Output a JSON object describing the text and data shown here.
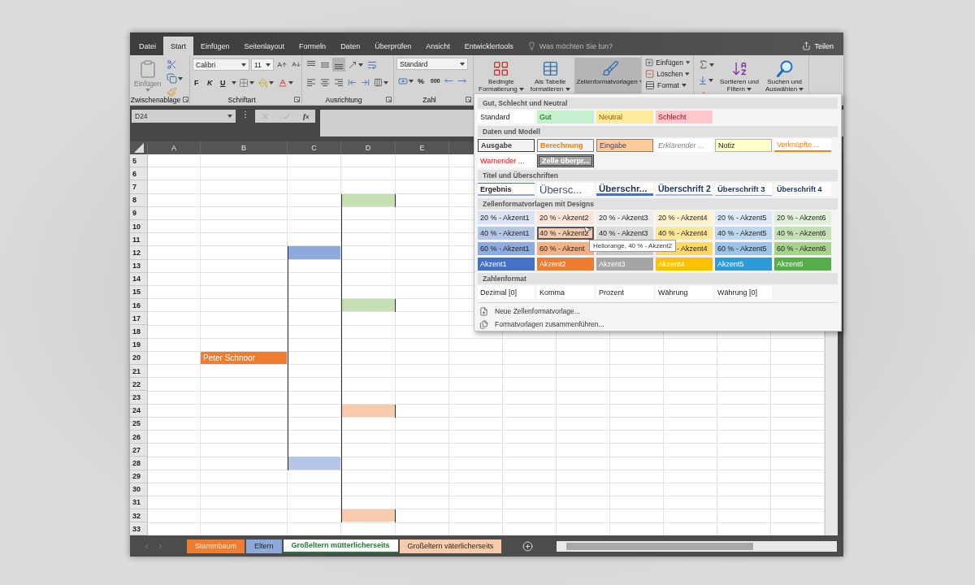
{
  "ribbon_tabs": [
    {
      "label": "Datei",
      "selected": false
    },
    {
      "label": "Start",
      "selected": true
    },
    {
      "label": "Einfügen",
      "selected": false
    },
    {
      "label": "Seitenlayout",
      "selected": false
    },
    {
      "label": "Formeln",
      "selected": false
    },
    {
      "label": "Daten",
      "selected": false
    },
    {
      "label": "Überprüfen",
      "selected": false
    },
    {
      "label": "Ansicht",
      "selected": false
    },
    {
      "label": "Entwicklertools",
      "selected": false
    }
  ],
  "tell_me": {
    "placeholder": "Was möchten Sie tun?"
  },
  "share": {
    "label": "Teilen"
  },
  "ribbon": {
    "clipboard": {
      "paste_label": "Einfügen",
      "group_label": "Zwischenablage"
    },
    "font": {
      "name": "Calibri",
      "size": "11",
      "bold": "F",
      "italic": "K",
      "underline": "U",
      "group_label": "Schriftart"
    },
    "alignment": {
      "vertical_buttons": [
        {
          "selected": false
        },
        {
          "selected": false
        },
        {
          "selected": true
        }
      ],
      "group_label": "Ausrichtung"
    },
    "number": {
      "format": "Standard",
      "percent": "%",
      "thousands": "000",
      "group_label": "Zahl"
    },
    "styles": [
      {
        "label": "Bedingte\nFormatierung",
        "kind": "conditional",
        "pressed": false
      },
      {
        "label": "Als Tabelle\nformatieren",
        "kind": "table",
        "pressed": false
      },
      {
        "label": "Zellenformatvorlagen",
        "kind": "cellstyles",
        "pressed": true
      }
    ],
    "cells": [
      {
        "label": "Einfügen",
        "kind": "insert"
      },
      {
        "label": "Löschen",
        "kind": "delete"
      },
      {
        "label": "Format",
        "kind": "format"
      }
    ],
    "editing": [
      {
        "label": "Sortieren und\nFiltern",
        "kind": "sort"
      },
      {
        "label": "Suchen und\nAuswählen",
        "kind": "find"
      }
    ]
  },
  "formula_bar": {
    "name_box": "D24",
    "function_label": "fx"
  },
  "columns": [
    "A",
    "B",
    "C",
    "D",
    "E"
  ],
  "rows": [
    {
      "number": "5"
    },
    {
      "number": "6"
    },
    {
      "number": "7"
    },
    {
      "number": "8",
      "d": {
        "color": "#c6e0b4",
        "line_left": true,
        "line_right": true
      }
    },
    {
      "number": "9",
      "d": {
        "line_left": true
      }
    },
    {
      "number": "10",
      "d": {
        "line_left": true
      }
    },
    {
      "number": "11",
      "d": {
        "line_left": true
      }
    },
    {
      "number": "12",
      "c": {
        "color": "#8eaadb",
        "line_left": true
      },
      "d": {
        "line_left": true
      }
    },
    {
      "number": "13",
      "c": {
        "line_left": true
      },
      "d": {
        "line_left": true
      }
    },
    {
      "number": "14",
      "c": {
        "line_left": true
      },
      "d": {
        "line_left": true
      }
    },
    {
      "number": "15",
      "c": {
        "line_left": true
      },
      "d": {
        "line_left": true
      }
    },
    {
      "number": "16",
      "c": {
        "line_left": true
      },
      "d": {
        "color": "#c6e0b4",
        "line_left": true,
        "line_right": true
      }
    },
    {
      "number": "17",
      "c": {
        "line_left": true
      },
      "d": {
        "line_left": true
      }
    },
    {
      "number": "18",
      "c": {
        "line_left": true
      },
      "d": {
        "line_left": true
      }
    },
    {
      "number": "19",
      "c": {
        "line_left": true
      },
      "d": {
        "line_left": true
      }
    },
    {
      "number": "20",
      "b": {
        "text": "Peter Schnoor",
        "color": "#ed7d31"
      },
      "c": {
        "line_left": true
      },
      "d": {
        "line_left": true
      }
    },
    {
      "number": "21",
      "c": {
        "line_left": true
      },
      "d": {
        "line_left": true
      }
    },
    {
      "number": "22",
      "c": {
        "line_left": true
      },
      "d": {
        "line_left": true
      }
    },
    {
      "number": "23",
      "c": {
        "line_left": true
      },
      "d": {
        "line_left": true
      }
    },
    {
      "number": "24",
      "c": {
        "line_left": true
      },
      "d": {
        "color": "#f8cbad",
        "line_left": true,
        "line_right": true
      }
    },
    {
      "number": "25",
      "c": {
        "line_left": true
      },
      "d": {
        "line_left": true
      }
    },
    {
      "number": "26",
      "c": {
        "line_left": true
      },
      "d": {
        "line_left": true
      }
    },
    {
      "number": "27",
      "c": {
        "line_left": true
      },
      "d": {
        "line_left": true
      }
    },
    {
      "number": "28",
      "c": {
        "color": "#b4c6e7",
        "line_left": true
      },
      "d": {
        "line_left": true
      }
    },
    {
      "number": "29",
      "d": {
        "line_left": true
      }
    },
    {
      "number": "30",
      "d": {
        "line_left": true
      }
    },
    {
      "number": "31",
      "d": {
        "line_left": true
      }
    },
    {
      "number": "32",
      "d": {
        "color": "#f8cbad",
        "line_left": true,
        "line_right": true
      }
    },
    {
      "number": "33"
    }
  ],
  "sheet_tabs": [
    {
      "label": "Stammbaum",
      "color": "#ed7d31",
      "selected": false
    },
    {
      "label": "Eltern",
      "color": "#8eaadb",
      "selected": false
    },
    {
      "label": "Großeltern mütterlicherseits",
      "color": "#ffffff",
      "selected": true
    },
    {
      "label": "Großeltern väterlicherseits",
      "color": "#f8cbad",
      "selected": false
    }
  ],
  "style_gallery": {
    "sections": [
      {
        "title": "Gut, Schlecht und Neutral",
        "rows": [
          [
            {
              "label": "Standard",
              "kind": "normal",
              "selected": false
            },
            {
              "label": "Gut",
              "kind": "good",
              "selected": false
            },
            {
              "label": "Neutral",
              "kind": "neutral",
              "selected": false
            },
            {
              "label": "Schlecht",
              "kind": "bad",
              "selected": false
            }
          ]
        ]
      },
      {
        "title": "Daten und Modell",
        "rows": [
          [
            {
              "label": "Ausgabe",
              "kind": "output",
              "selected": false
            },
            {
              "label": "Berechnung",
              "kind": "calc",
              "selected": false
            },
            {
              "label": "Eingabe",
              "kind": "input",
              "selected": false
            },
            {
              "label": "Erklärender ...",
              "kind": "explanatory",
              "selected": false
            },
            {
              "label": "Notiz",
              "kind": "note",
              "selected": false
            },
            {
              "label": "Verknüpfte ...",
              "kind": "linked",
              "selected": false
            }
          ],
          [
            {
              "label": "Warnender ...",
              "kind": "warning",
              "selected": false
            },
            {
              "label": "Zelle überpr...",
              "kind": "check",
              "selected": false
            }
          ]
        ]
      },
      {
        "title": "Titel und Überschriften",
        "rows": [
          [
            {
              "label": "Ergebnis",
              "kind": "total",
              "selected": false
            },
            {
              "label": "Übersc...",
              "kind": "title",
              "selected": false
            },
            {
              "label": "Überschr...",
              "kind": "h1",
              "selected": false
            },
            {
              "label": "Überschrift 2",
              "kind": "h2",
              "selected": false
            },
            {
              "label": "Überschrift 3",
              "kind": "h3",
              "selected": false
            },
            {
              "label": "Überschrift 4",
              "kind": "h4",
              "selected": false
            }
          ]
        ]
      },
      {
        "title": "Zellenformatvorlagen mit Designs",
        "rows": [
          [
            {
              "label": "20 % - Akzent1",
              "kind": "fill",
              "color": "#dae3f3",
              "selected": false
            },
            {
              "label": "20 % - Akzent2",
              "kind": "fill",
              "color": "#fbe5d6",
              "selected": false
            },
            {
              "label": "20 % - Akzent3",
              "kind": "fill",
              "color": "#ededed",
              "selected": false
            },
            {
              "label": "20 % - Akzent4",
              "kind": "fill",
              "color": "#fff2cc",
              "selected": false
            },
            {
              "label": "20 % - Akzent5",
              "kind": "fill",
              "color": "#deebf7",
              "selected": false
            },
            {
              "label": "20 % - Akzent6",
              "kind": "fill",
              "color": "#e2f0d9",
              "selected": false
            }
          ],
          [
            {
              "label": "40 % - Akzent1",
              "kind": "fill",
              "color": "#b4c7e7",
              "selected": false
            },
            {
              "label": "40 % - Akzent2",
              "kind": "fill",
              "color": "#f8cbad",
              "selected": true
            },
            {
              "label": "40 % - Akzent3",
              "kind": "fill",
              "color": "#dbdbdb",
              "selected": false
            },
            {
              "label": "40 % - Akzent4",
              "kind": "fill",
              "color": "#ffe699",
              "selected": false
            },
            {
              "label": "40 % - Akzent5",
              "kind": "fill",
              "color": "#bdd7ee",
              "selected": false
            },
            {
              "label": "40 % - Akzent6",
              "kind": "fill",
              "color": "#c5e0b4",
              "selected": false
            }
          ],
          [
            {
              "label": "60 % - Akzent1",
              "kind": "fill",
              "color": "#8faadc",
              "selected": false
            },
            {
              "label": "60 % - Akzent",
              "kind": "fill",
              "color": "#f4b183",
              "selected": false
            },
            {
              "kind": "fill",
              "color": "#c9c9c9",
              "selected": false
            },
            {
              "label": "- Akzent4",
              "kind": "fill",
              "color": "#ffd966",
              "clipped": true,
              "selected": false
            },
            {
              "label": "60 % - Akzent5",
              "kind": "fill",
              "color": "#9dc3e6",
              "selected": false
            },
            {
              "label": "60 % - Akzent6",
              "kind": "fill",
              "color": "#a9d18e",
              "selected": false
            }
          ],
          [
            {
              "label": "Akzent1",
              "kind": "solid",
              "color": "#4472c4",
              "selected": false
            },
            {
              "label": "Akzent2",
              "kind": "solid",
              "color": "#ed7d31",
              "selected": false
            },
            {
              "label": "Akzent3",
              "kind": "solid",
              "color": "#a5a5a5",
              "selected": false
            },
            {
              "label": "Akzent4",
              "kind": "solid",
              "color": "#ffc000",
              "selected": false
            },
            {
              "label": "Akzent5",
              "kind": "solid",
              "color": "#2e9ad9",
              "selected": false
            },
            {
              "label": "Akzent6",
              "kind": "solid",
              "color": "#56ad4a",
              "selected": false
            }
          ]
        ]
      },
      {
        "title": "Zahlenformat",
        "rows": [
          [
            {
              "label": "Dezimal [0]",
              "kind": "normal",
              "selected": false
            },
            {
              "label": "Komma",
              "kind": "normal",
              "selected": false
            },
            {
              "label": "Prozent",
              "kind": "normal",
              "selected": false
            },
            {
              "label": "Währung",
              "kind": "normal",
              "selected": false
            },
            {
              "label": "Währung [0]",
              "kind": "normal",
              "selected": false
            }
          ]
        ]
      }
    ],
    "menu": [
      {
        "label": "Neue Zellenformatvorlage...",
        "kind": "new"
      },
      {
        "label": "Formatvorlagen zusammenführen...",
        "kind": "merge"
      }
    ],
    "tooltip": "Hellorange, 40 % - Akzent2"
  }
}
